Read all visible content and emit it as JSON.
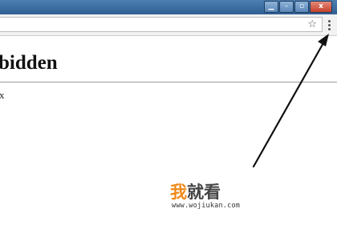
{
  "titlebar": {
    "controls": [
      {
        "name": "restore-icon",
        "glyph": "▁"
      },
      {
        "name": "minimize-icon",
        "glyph": "–"
      },
      {
        "name": "maximize-icon",
        "glyph": "▫"
      },
      {
        "name": "close-icon",
        "glyph": "x"
      }
    ]
  },
  "toolbar": {
    "star_glyph": "☆",
    "menu_icon": "vertical-dots-icon"
  },
  "page": {
    "heading": "bidden",
    "body_text": "x"
  },
  "annotation": {
    "arrow_color": "#111111",
    "points_to": "browser-menu-button"
  },
  "watermark": {
    "logo_accent": "我",
    "logo_rest": "就看",
    "url": "www.wojiukan.com",
    "accent_color": "#f08a1a"
  }
}
